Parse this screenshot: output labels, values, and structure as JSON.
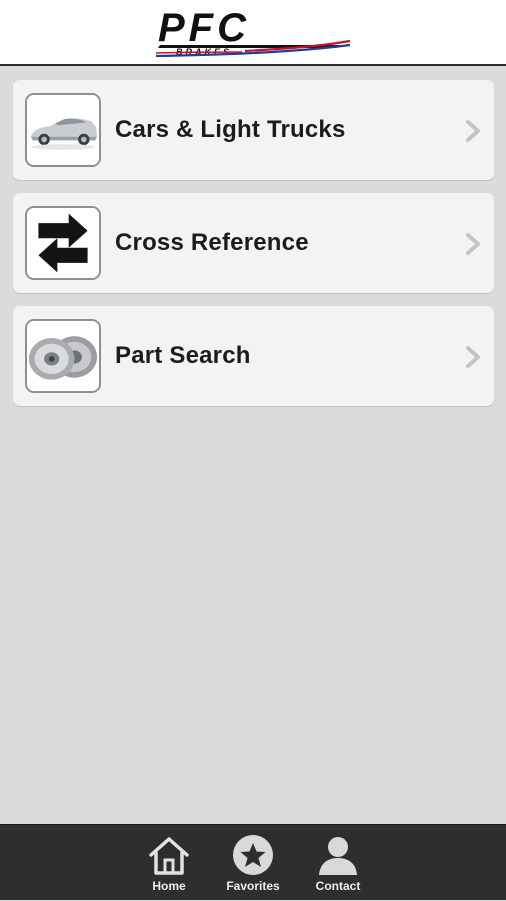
{
  "header": {
    "logo_text": "PFC",
    "logo_subtext": "BRAKES"
  },
  "menu": {
    "items": [
      {
        "label": "Cars & Light Trucks",
        "icon": "car-icon"
      },
      {
        "label": "Cross Reference",
        "icon": "swap-arrows-icon"
      },
      {
        "label": "Part Search",
        "icon": "brake-rotor-icon"
      }
    ]
  },
  "tabbar": {
    "tabs": [
      {
        "label": "Home",
        "icon": "home-icon"
      },
      {
        "label": "Favorites",
        "icon": "star-icon"
      },
      {
        "label": "Contact",
        "icon": "person-icon"
      }
    ]
  },
  "colors": {
    "background": "#dcdbdc",
    "card": "#f3f3f3",
    "tabbar": "#2e2e2e",
    "logo_red": "#c8102e",
    "logo_blue": "#1f3f8f"
  }
}
